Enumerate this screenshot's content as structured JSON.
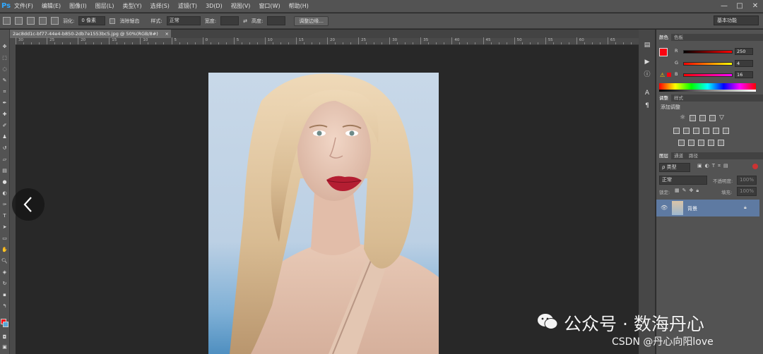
{
  "app": {
    "logo": "Ps"
  },
  "menubar": {
    "items": [
      "文件(F)",
      "编辑(E)",
      "图像(I)",
      "图层(L)",
      "类型(Y)",
      "选择(S)",
      "滤镜(T)",
      "3D(D)",
      "视图(V)",
      "窗口(W)",
      "帮助(H)"
    ],
    "window_controls": [
      "—",
      "□",
      "✕"
    ]
  },
  "options": {
    "feather_label": "羽化:",
    "feather_value": "0 像素",
    "antialias_label": "消除锯齿",
    "style_label": "样式:",
    "style_value": "正常",
    "width_label": "宽度:",
    "height_label": "高度:",
    "refine_button": "调整边缘...",
    "workspace": "基本功能"
  },
  "document": {
    "tab_title": "2ac8dd1c-bf77-44e4-b850-2db7e1553bc5.jpg @ 50%(RGB/8#)",
    "close": "×"
  },
  "ruler": {
    "ticks": [
      "30",
      "25",
      "20",
      "15",
      "10",
      "5",
      "0",
      "5",
      "10",
      "15",
      "20",
      "25",
      "30",
      "35",
      "40",
      "45",
      "50",
      "55",
      "60",
      "65"
    ]
  },
  "color_panel": {
    "tabs": [
      "颜色",
      "色板"
    ],
    "channels": [
      {
        "label": "R",
        "value": "250",
        "gradient": "#ff0000"
      },
      {
        "label": "G",
        "value": "4",
        "gradient": "#ffff00"
      },
      {
        "label": "B",
        "value": "16",
        "gradient": "#ff00ff"
      }
    ],
    "fg_color": "#fa0410",
    "bg_color": "#5aa8d8"
  },
  "adjust_panel": {
    "tabs": [
      "调整",
      "样式"
    ],
    "title": "添加调整"
  },
  "layers_panel": {
    "tabs": [
      "图层",
      "通道",
      "路径"
    ],
    "kind_filter": "ρ 类型",
    "blend_mode": "正常",
    "opacity_label": "不透明度:",
    "opacity_value": "100%",
    "lock_label": "锁定:",
    "fill_label": "填充:",
    "fill_value": "100%",
    "layer_name": "背景"
  },
  "watermark": {
    "line1": "公众号 · 数海丹心",
    "line2": "CSDN @丹心向阳love"
  }
}
